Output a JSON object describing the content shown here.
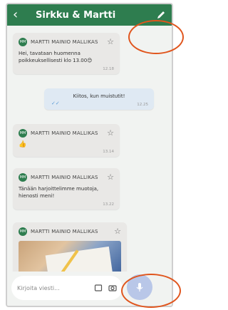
{
  "header": {
    "back_icon": "chevron-left-icon",
    "title": "Sirkku & Martti",
    "edit_icon": "pencil-icon"
  },
  "colors": {
    "header": "#2e7d4f",
    "incoming_bubble": "#e9e8e6",
    "outgoing_bubble": "#dfe9f3",
    "annotation": "#e0551d",
    "mic_button": "#b9c7e8"
  },
  "messages": [
    {
      "avatar_text": "MM",
      "sender": "MARTTI MAINIO MALLIKAS",
      "text": "Hei, tavataan huomenna poikkeuksellisesti klo 13.00😊",
      "time": "12.18"
    },
    {
      "text": "Kiitos, kun muistutit!",
      "time": "12.25"
    },
    {
      "avatar_text": "MM",
      "sender": "MARTTI MAINIO MALLIKAS",
      "emoji": "👍",
      "time": "13.14"
    },
    {
      "avatar_text": "MM",
      "sender": "MARTTI MAINIO MALLIKAS",
      "text": "Tänään harjoittelimme muotoja, hienosti meni!",
      "time": "13.22"
    },
    {
      "avatar_text": "MM",
      "sender": "MARTTI MAINIO MALLIKAS"
    }
  ],
  "composer": {
    "placeholder": "Kirjoita viesti...",
    "icons": [
      "attachment-icon",
      "camera-icon",
      "microphone-icon"
    ]
  }
}
